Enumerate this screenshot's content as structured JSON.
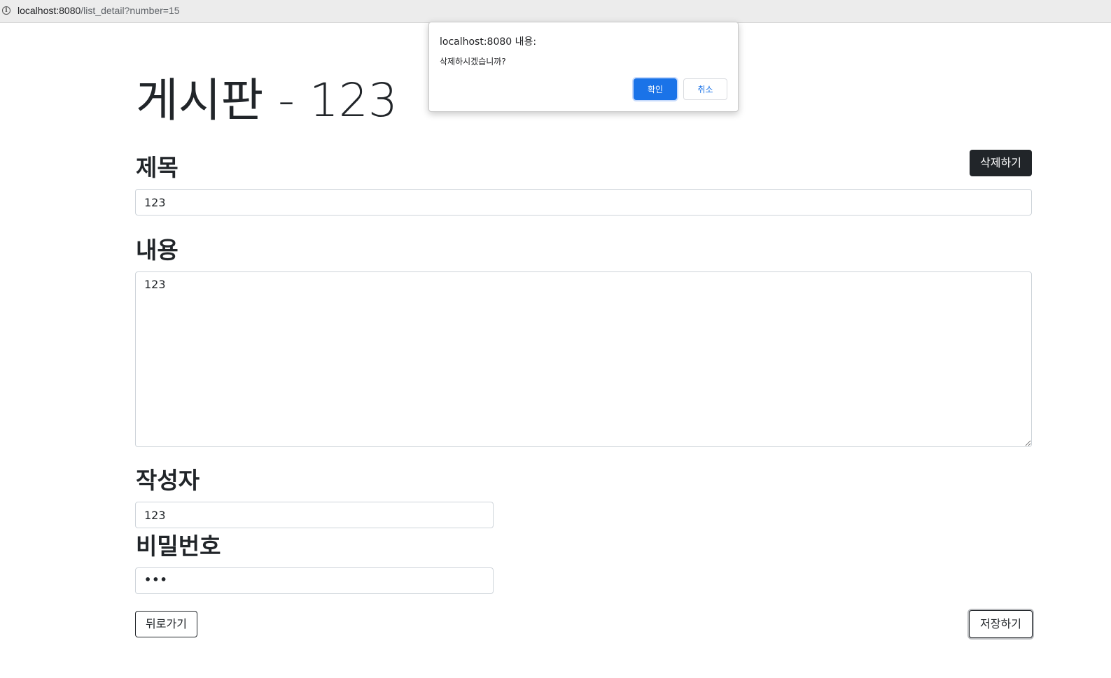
{
  "browser": {
    "url_host": "localhost:8080",
    "url_path": "/list_detail?number=15",
    "info_icon": "info-icon"
  },
  "page": {
    "title": "게시판 - 123",
    "delete_button": "삭제하기",
    "title_label": "제목",
    "title_value": "123",
    "content_label": "내용",
    "content_value": "123",
    "author_label": "작성자",
    "author_value": "123",
    "password_label": "비밀번호",
    "password_mask": "•••",
    "back_button": "뒤로가기",
    "save_button": "저장하기"
  },
  "dialog": {
    "title": "localhost:8080 내용:",
    "message": "삭제하시겠습니까?",
    "ok_label": "확인",
    "cancel_label": "취소"
  },
  "colors": {
    "confirm_accent": "#1a73e8",
    "dark_button": "#212529"
  }
}
